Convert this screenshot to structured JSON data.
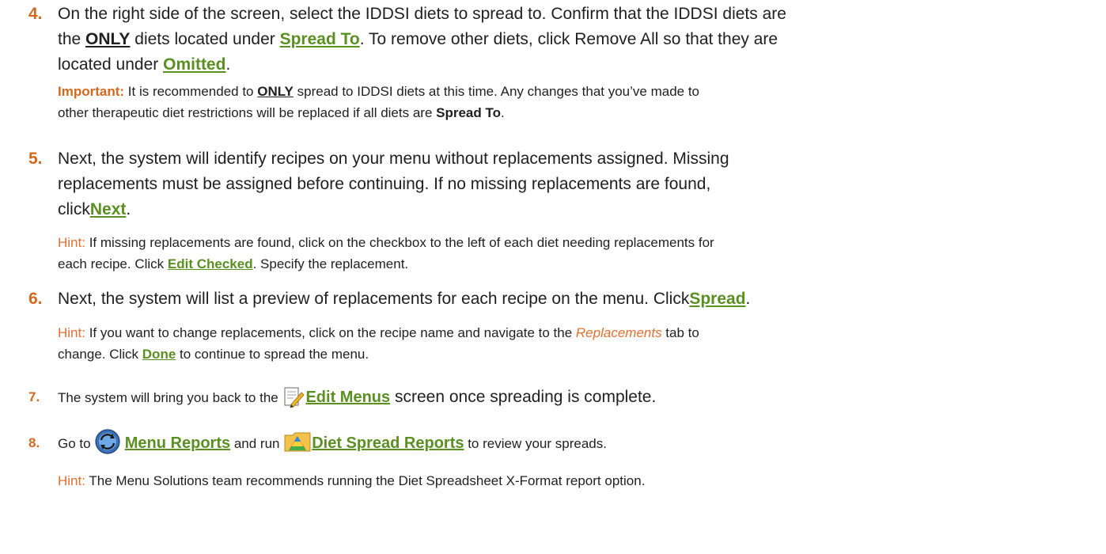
{
  "steps": [
    {
      "number": "4.",
      "line1_a": "On the right side of the screen, select the IDDSI diets to spread to. Confirm that the IDDSI diets are",
      "line2_a": "the ",
      "line2_only": "ONLY",
      "line2_b": " diets located under ",
      "line2_link": "Spread To",
      "line2_c": ". To remove other diets, click Remove All so that they are",
      "line3_a": "located under ",
      "line3_link": "Omitted",
      "line3_b": ".",
      "important_label": "Important:",
      "imp_a": " It is recommended to ",
      "imp_only": "ONLY",
      "imp_b": " spread to IDDSI diets at this time. Any changes that you’ve made to",
      "imp2_a": "other therapeutic diet restrictions will be replaced if all diets are ",
      "imp2_bold": "Spread To",
      "imp2_b": "."
    },
    {
      "number": "5.",
      "line1": "Next, the system will identify recipes on your menu without replacements assigned. Missing",
      "line2": "replacements must be assigned before continuing. If no missing replacements are found,",
      "line3_a": "click",
      "line3_link": "Next",
      "line3_b": ".",
      "hint_label": "Hint:",
      "hint_a": " If missing replacements are found, click on the checkbox to the left of each diet needing replacements for",
      "hint2_a": "each recipe. Click ",
      "hint2_link": "Edit Checked",
      "hint2_b": ". Specify the replacement."
    },
    {
      "number": "6.",
      "line1_a": "Next, the system will list a preview of replacements for each recipe on the menu. Click",
      "line1_link": "Spread",
      "line1_b": ".",
      "hint_label": "Hint:",
      "hint_a": " If you want to change replacements, click on the recipe name and navigate to the ",
      "hint_italic": "Replacements",
      "hint_b": " tab to",
      "hint2_a": "change. Click ",
      "hint2_link": "Done",
      "hint2_b": " to continue to spread the menu."
    },
    {
      "number": "7.",
      "text_a": "The system will bring you back to the ",
      "icon": "edit-menus-icon",
      "link": "Edit Menus",
      "text_b": " screen once spreading is complete."
    },
    {
      "number": "8.",
      "text_a": "Go to ",
      "icon1": "menu-reports-icon",
      "link1": "Menu Reports",
      "text_b": " and run ",
      "icon2": "diet-spread-reports-icon",
      "link2": "Diet Spread Reports",
      "text_c": " to review your spreads.",
      "hint_label": "Hint:",
      "hint_a": " The Menu Solutions team recommends running the Diet Spreadsheet X-Format report option."
    }
  ],
  "colors": {
    "accent": "#d2691e",
    "link": "#5a8f22",
    "hint": "#e07030"
  }
}
